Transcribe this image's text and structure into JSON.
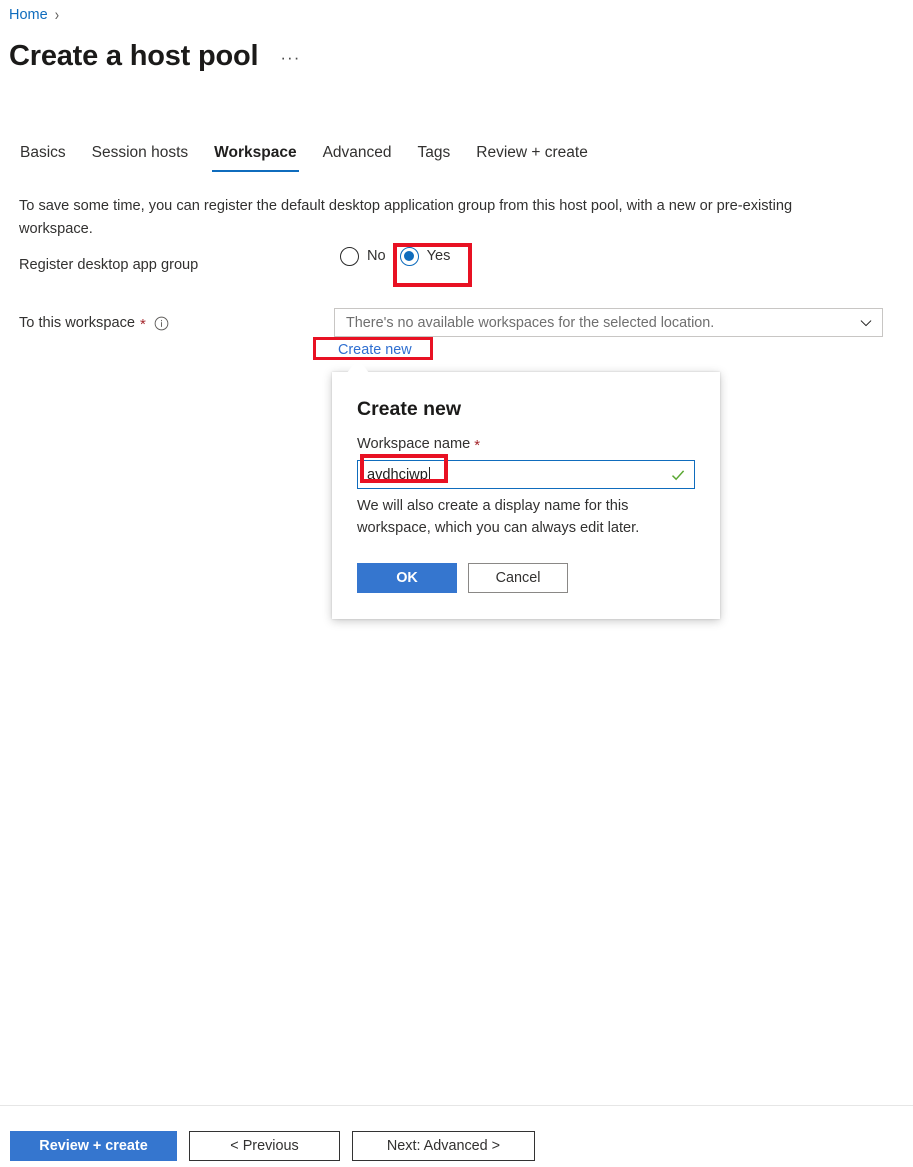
{
  "breadcrumb": {
    "home_label": "Home",
    "separator": "›"
  },
  "header": {
    "title": "Create a host pool",
    "ellipsis": "···"
  },
  "tabs": [
    {
      "label": "Basics",
      "active": false
    },
    {
      "label": "Session hosts",
      "active": false
    },
    {
      "label": "Workspace",
      "active": true
    },
    {
      "label": "Advanced",
      "active": false
    },
    {
      "label": "Tags",
      "active": false
    },
    {
      "label": "Review + create",
      "active": false
    }
  ],
  "main": {
    "description": "To save some time, you can register the default desktop application group from this host pool, with a new or pre-existing workspace.",
    "register_row": {
      "label": "Register desktop app group",
      "options": [
        {
          "label": "No",
          "selected": false
        },
        {
          "label": "Yes",
          "selected": true
        }
      ]
    },
    "workspace_row": {
      "label": "To this workspace",
      "required_marker": "*",
      "info_icon": "info-circle-icon",
      "dropdown_value": "There's no available workspaces for the selected location.",
      "dropdown_icon": "chevron-down-icon",
      "create_new_label": "Create new"
    }
  },
  "callout": {
    "title": "Create new",
    "field_label": "Workspace name",
    "required_marker": "*",
    "input_value": "avdhciwp",
    "validation_icon": "checkmark-icon",
    "help_text": "We will also create a display name for this workspace, which you can always edit later.",
    "ok_label": "OK",
    "cancel_label": "Cancel"
  },
  "footer": {
    "review_label": "Review + create",
    "previous_label": "< Previous",
    "next_label": "Next: Advanced >"
  },
  "colors": {
    "accent": "#0f6cbd",
    "primary_button": "#3576cf",
    "link": "#2f6fd0",
    "required": "#a4262c",
    "annotation": "#e81123",
    "validation_ok": "#5aa832"
  }
}
